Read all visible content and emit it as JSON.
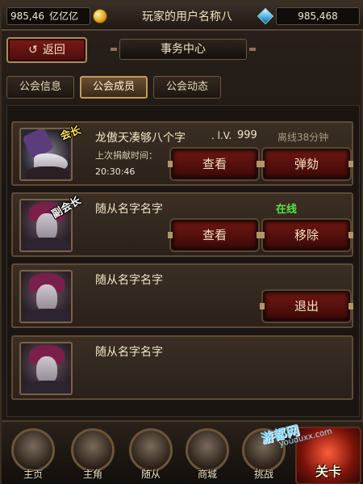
{
  "topbar": {
    "gold_value": "985,46",
    "gold_unit": "亿亿亿",
    "username": "玩家的用户名称八",
    "gem_value": "985,468"
  },
  "header": {
    "back_label": "返回",
    "title": "事务中心"
  },
  "tabs": [
    {
      "label": "公会信息",
      "active": false
    },
    {
      "label": "公会成员",
      "active": true
    },
    {
      "label": "公会动态",
      "active": false
    }
  ],
  "members": [
    {
      "rank": "会长",
      "name": "龙傲天凑够八个字",
      "lv_label": ". l.V.",
      "lv": "999",
      "status": "离线38分钟",
      "contrib_label": "上次捐献时间：",
      "contrib_time": "20:30:46",
      "left_button": "查看",
      "right_button": "弹劾"
    },
    {
      "rank": "副会长",
      "name": "随从名字名字",
      "status": "在线",
      "left_button": "查看",
      "right_button": "移除"
    },
    {
      "name": "随从名字名字",
      "right_button": "退出"
    },
    {
      "name": "随从名字名字"
    }
  ],
  "nav": {
    "home": "主页",
    "hero": "主角",
    "follower": "随从",
    "shop": "商城",
    "challenge": "挑战",
    "stage": "关卡"
  },
  "watermark": {
    "text": "游都网",
    "url": "youduxx.com"
  }
}
